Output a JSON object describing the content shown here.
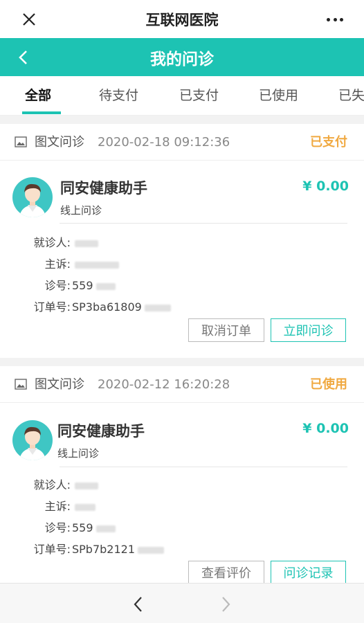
{
  "app_title": "互联网医院",
  "nav_title": "我的问诊",
  "tabs": [
    "全部",
    "待支付",
    "已支付",
    "已使用",
    "已失"
  ],
  "colors": {
    "accent": "#1dc3b3",
    "status": "#f0a941"
  },
  "orders": [
    {
      "type": "图文问诊",
      "time": "2020-02-18 09:12:36",
      "status": "已支付",
      "doctor": "同安健康助手",
      "service": "线上问诊",
      "price": "¥ 0.00",
      "fields": [
        {
          "label": "就诊人:",
          "value": ""
        },
        {
          "label": "主诉:",
          "value": ""
        },
        {
          "label": "诊号:",
          "value": "559"
        },
        {
          "label": "订单号:",
          "value": "SP3ba61809"
        }
      ],
      "buttons": [
        "取消订单",
        "立即问诊"
      ]
    },
    {
      "type": "图文问诊",
      "time": "2020-02-12 16:20:28",
      "status": "已使用",
      "doctor": "同安健康助手",
      "service": "线上问诊",
      "price": "¥ 0.00",
      "fields": [
        {
          "label": "就诊人:",
          "value": ""
        },
        {
          "label": "主诉:",
          "value": ""
        },
        {
          "label": "诊号:",
          "value": "559"
        },
        {
          "label": "订单号:",
          "value": "SPb7b2121"
        }
      ],
      "buttons": [
        "查看评价",
        "问诊记录"
      ]
    }
  ]
}
